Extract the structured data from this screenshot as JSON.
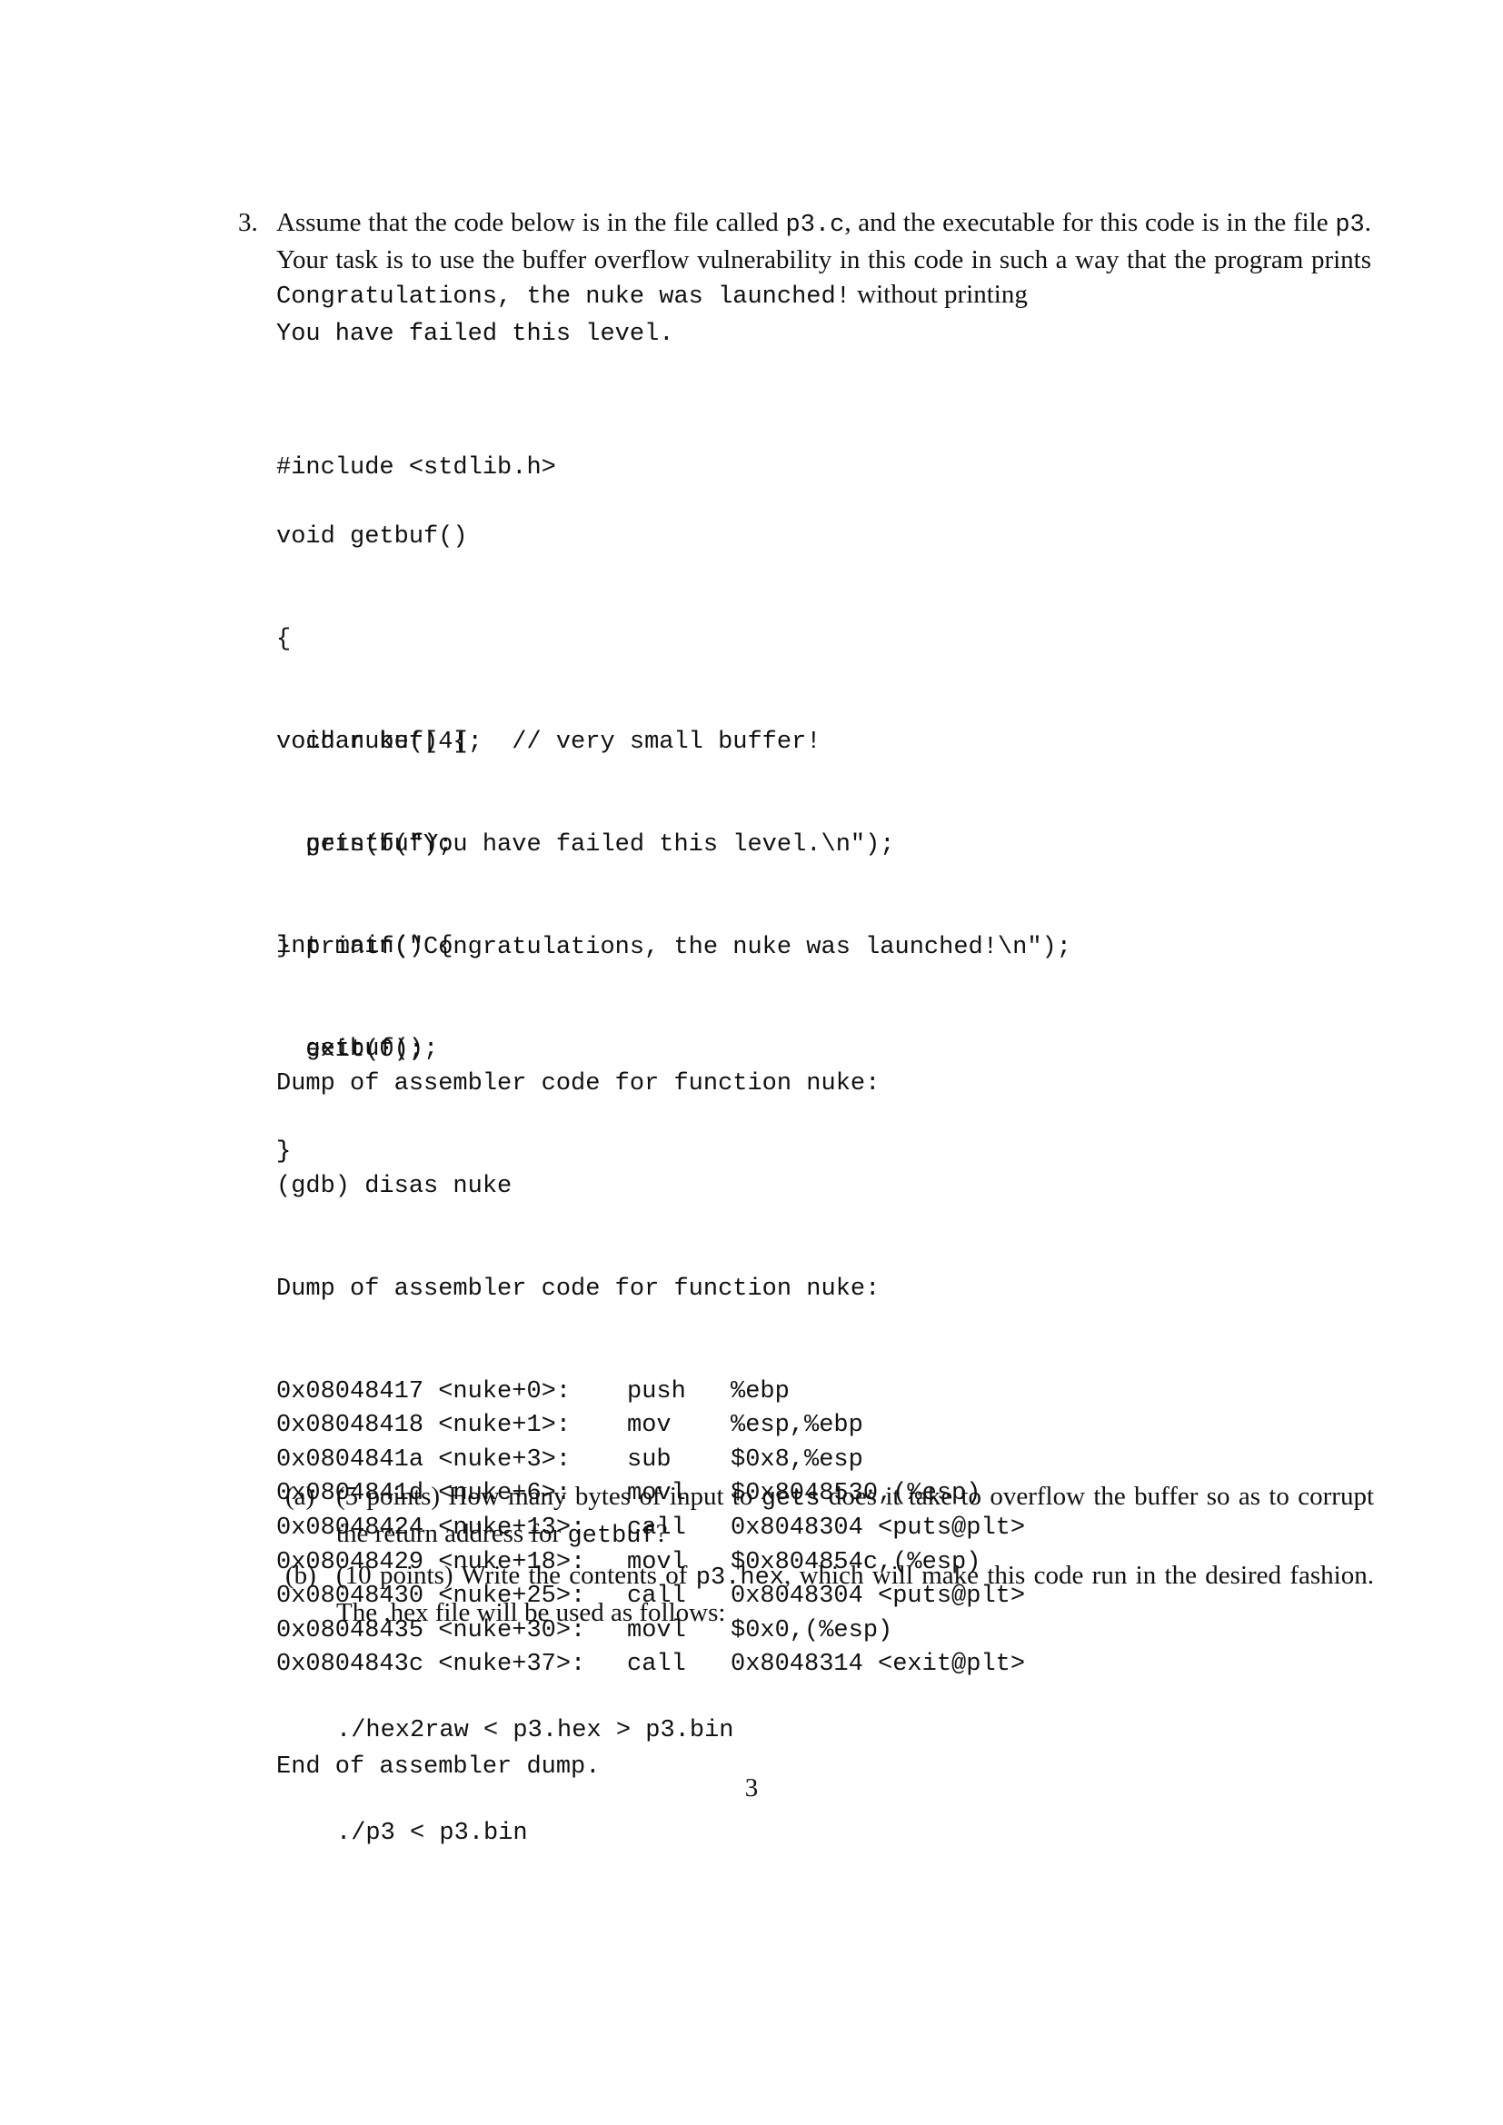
{
  "problem": {
    "number": "3.",
    "intro_parts": [
      "Assume that the code below is in the file called ",
      "p3.c",
      ", and the executable for this code is in the file ",
      "p3",
      ". Your task is to use the buffer overflow vulnerability in this code in such a way that the program prints ",
      "Congratulations, the nuke was launched!",
      " without printing ",
      "You have failed this level."
    ]
  },
  "source_code": {
    "include": "#include <stdlib.h>",
    "getbuf": [
      "void getbuf()",
      "{",
      "  char buf[4];  // very small buffer!",
      "  gets(buf);",
      "}"
    ],
    "nuke": [
      "void nuke() {",
      "  printf(\"You have failed this level.\\n\");",
      "  printf(\"Congratulations, the nuke was launched!\\n\");",
      "  exit(0);",
      "}"
    ],
    "main": [
      "int main() {",
      "  getbuf();",
      "}"
    ]
  },
  "assembler_dump": {
    "header_lines": [
      "Dump of assembler code for function nuke:",
      "(gdb) disas nuke",
      "Dump of assembler code for function nuke:"
    ],
    "rows": [
      {
        "addr": "0x08048417 <nuke+0>:",
        "op": "push",
        "args": "%ebp"
      },
      {
        "addr": "0x08048418 <nuke+1>:",
        "op": "mov",
        "args": "%esp,%ebp"
      },
      {
        "addr": "0x0804841a <nuke+3>:",
        "op": "sub",
        "args": "$0x8,%esp"
      },
      {
        "addr": "0x0804841d <nuke+6>:",
        "op": "movl",
        "args": "$0x8048530,(%esp)"
      },
      {
        "addr": "0x08048424 <nuke+13>:",
        "op": "call",
        "args": "0x8048304 <puts@plt>"
      },
      {
        "addr": "0x08048429 <nuke+18>:",
        "op": "movl",
        "args": "$0x804854c,(%esp)"
      },
      {
        "addr": "0x08048430 <nuke+25>:",
        "op": "call",
        "args": "0x8048304 <puts@plt>"
      },
      {
        "addr": "0x08048435 <nuke+30>:",
        "op": "movl",
        "args": "$0x0,(%esp)"
      },
      {
        "addr": "0x0804843c <nuke+37>:",
        "op": "call",
        "args": "0x8048314 <exit@plt>"
      }
    ],
    "footer": "End of assembler dump."
  },
  "subquestions": [
    {
      "label": "(a)",
      "parts": [
        "(5 points) How many bytes of input to ",
        "gets",
        " does it take to overflow the buffer so as to corrupt the return address for ",
        "getbuf",
        "?"
      ]
    },
    {
      "label": "(b)",
      "parts": [
        "(10 points) Write the contents of ",
        "p3.hex",
        ", which will make this code run in the desired fashion. The .hex file will be used as follows:"
      ]
    }
  ],
  "commands": [
    "./hex2raw < p3.hex > p3.bin",
    "./p3 < p3.bin"
  ],
  "page_number": "3"
}
